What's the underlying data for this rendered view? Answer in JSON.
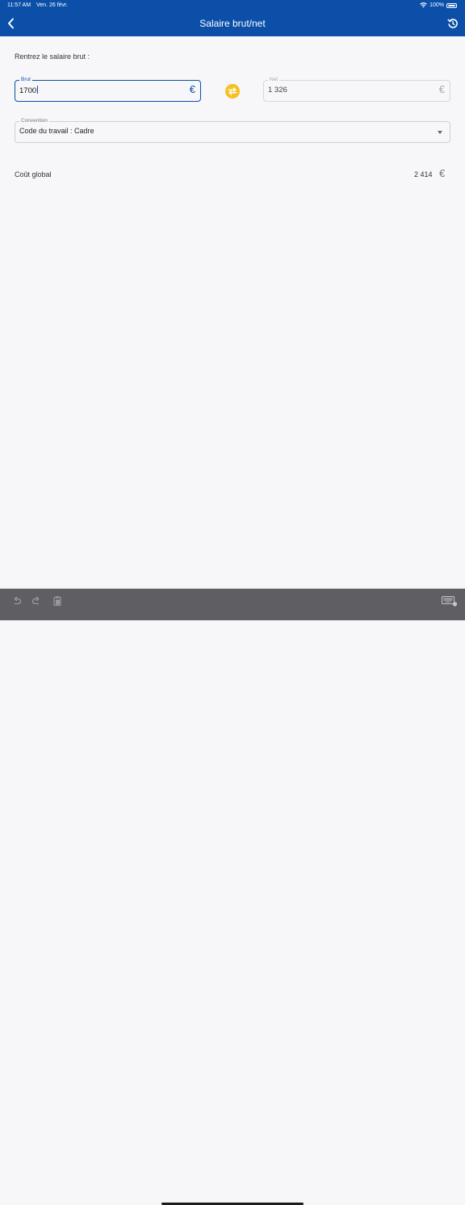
{
  "status_bar": {
    "time": "11:57 AM",
    "date": "Ven. 26 févr.",
    "battery": "100%"
  },
  "header": {
    "title": "Salaire brut/net",
    "back_icon": "chevron-left-icon",
    "history_icon": "history-icon"
  },
  "form": {
    "prompt": "Rentrez le salaire brut :",
    "brut": {
      "label": "Brut",
      "value": "1700",
      "currency": "€"
    },
    "net": {
      "label": "Net",
      "value": "1 326",
      "currency": "€"
    },
    "swap_icon": "swap-arrows-icon",
    "convention": {
      "label": "Convention",
      "value": "Code du travail : Cadre"
    }
  },
  "cost": {
    "label": "Coût global",
    "value": "2 414",
    "currency": "€"
  },
  "keyboard_toolbar": {
    "icons": [
      "undo-icon",
      "redo-icon",
      "paste-icon",
      "keyboard-icon"
    ]
  },
  "colors": {
    "brand_blue": "#0b4fa9",
    "swap_yellow": "#f6c023"
  }
}
